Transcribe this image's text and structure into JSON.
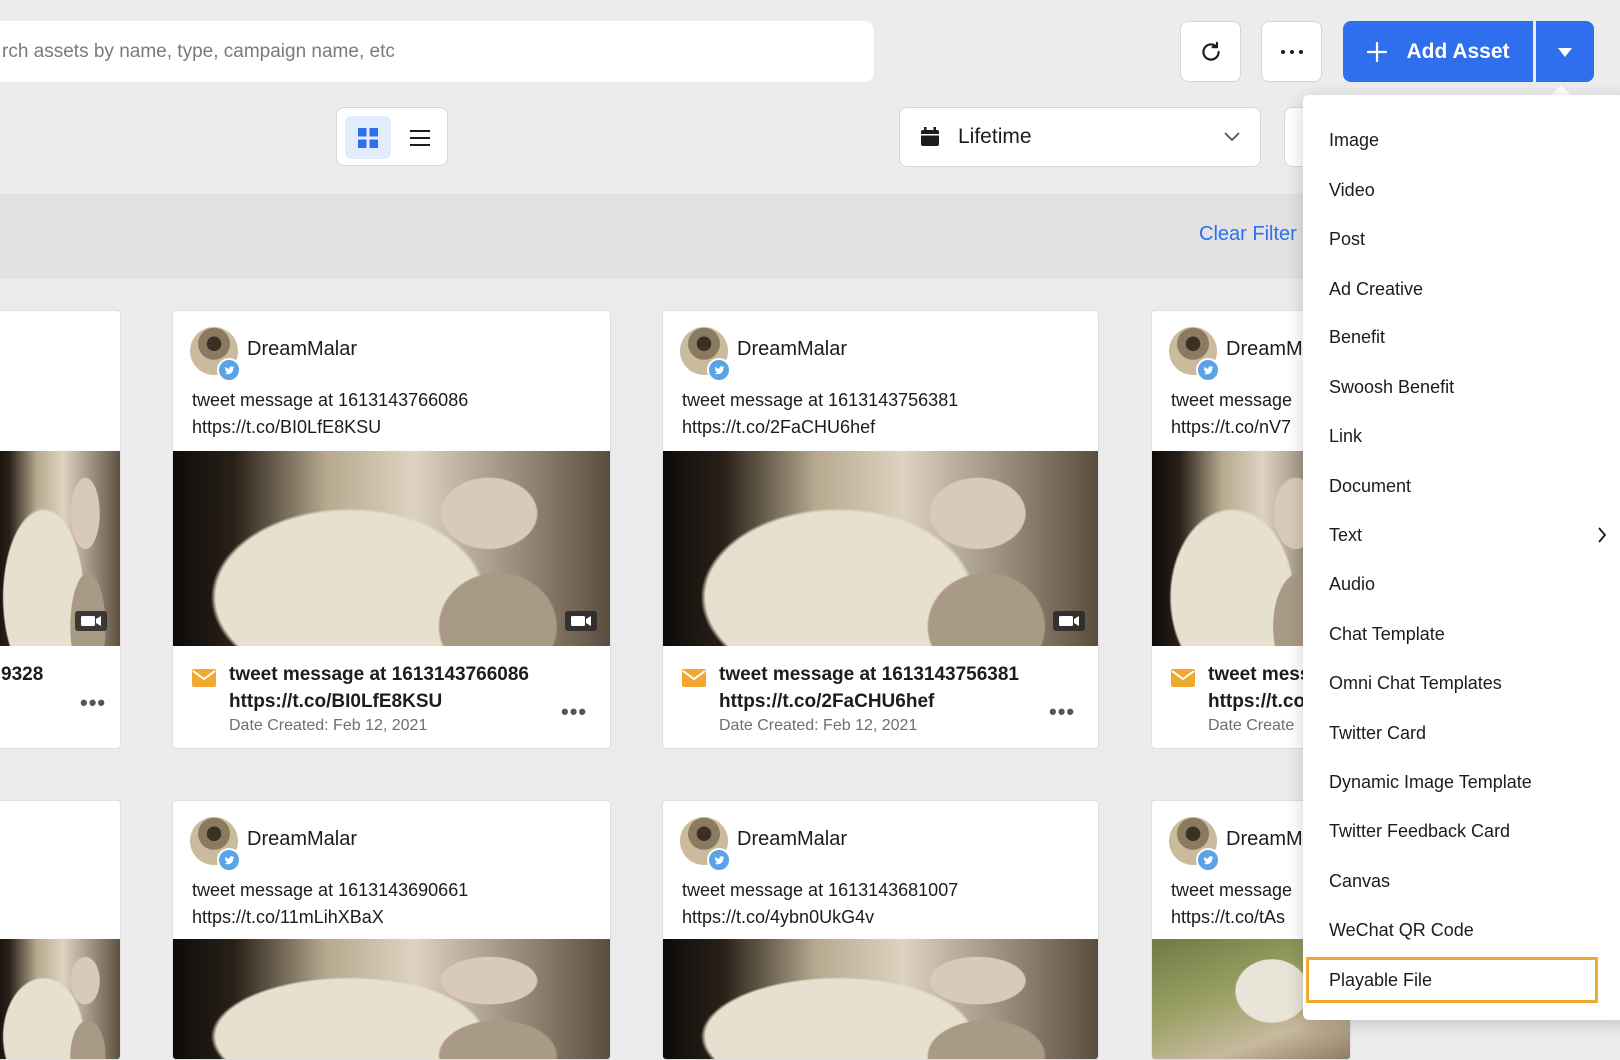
{
  "search": {
    "placeholder": "rch assets by name, type, campaign name, etc"
  },
  "toolbar": {
    "add_label": "Add Asset"
  },
  "date_filter": {
    "value": "Lifetime"
  },
  "filters": {
    "clear_label": "Clear Filter"
  },
  "cards_row1": [
    {
      "footer_text": "9328"
    },
    {
      "author": "DreamMalar",
      "msg1": "tweet message at 1613143766086",
      "msg2": "https://t.co/BI0LfE8KSU",
      "foot1": "tweet message at 1613143766086",
      "foot2": "https://t.co/BI0LfE8KSU",
      "date": "Date Created: Feb 12, 2021"
    },
    {
      "author": "DreamMalar",
      "msg1": "tweet message at 1613143756381",
      "msg2": "https://t.co/2FaCHU6hef",
      "foot1": "tweet message at 1613143756381",
      "foot2": "https://t.co/2FaCHU6hef",
      "date": "Date Created: Feb 12, 2021"
    },
    {
      "author": "DreamM",
      "msg1": "tweet message",
      "msg2": "https://t.co/nV7",
      "foot1": "tweet mess",
      "foot2": "https://t.co",
      "date": "Date Create"
    }
  ],
  "cards_row2": [
    {
      "author": "DreamMalar",
      "msg1": "tweet message at 1613143690661",
      "msg2": "https://t.co/11mLihXBaX"
    },
    {
      "author": "DreamMalar",
      "msg1": "tweet message at 1613143681007",
      "msg2": "https://t.co/4ybn0UkG4v"
    },
    {
      "author": "DreamM",
      "msg1": "tweet message",
      "msg2": "https://t.co/tAs"
    }
  ],
  "menu": {
    "items": [
      "Image",
      "Video",
      "Post",
      "Ad Creative",
      "Benefit",
      "Swoosh Benefit",
      "Link",
      "Document",
      "Text",
      "Audio",
      "Chat Template",
      "Omni Chat Templates",
      "Twitter Card",
      "Dynamic Image Template",
      "Twitter Feedback Card",
      "Canvas",
      "WeChat QR Code",
      "Playable File"
    ],
    "focused": "Playable File"
  }
}
